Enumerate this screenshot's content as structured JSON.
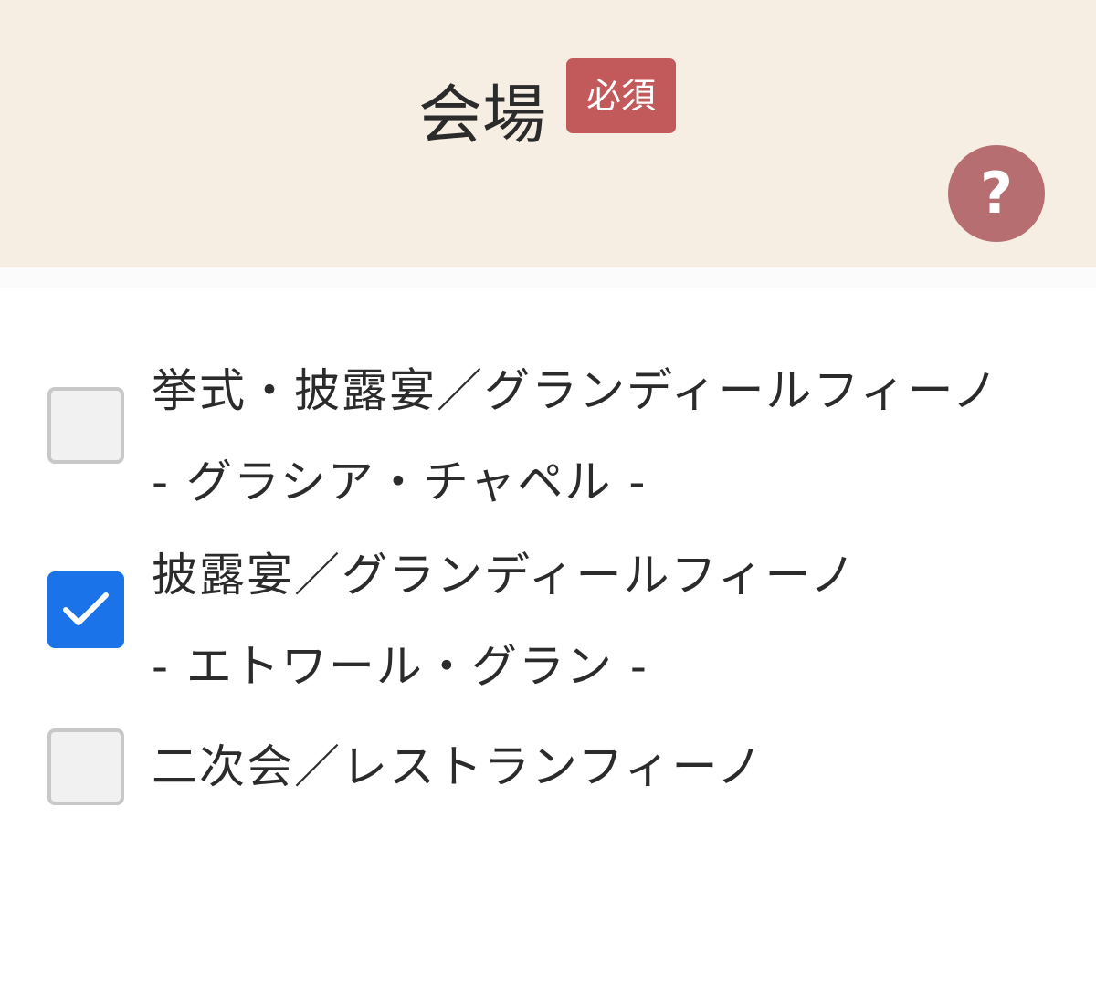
{
  "header": {
    "title": "会場",
    "required_badge": "必須",
    "help_icon": "question-mark-icon",
    "help_symbol": "?"
  },
  "options": [
    {
      "line1": "挙式・披露宴／グランディールフィーノ",
      "line2": "- グラシア・チャペル -",
      "checked": false
    },
    {
      "line1": "披露宴／グランディールフィーノ",
      "line2": "- エトワール・グラン -",
      "checked": true
    },
    {
      "line1": "二次会／レストランフィーノ",
      "line2": "",
      "checked": false
    }
  ],
  "colors": {
    "header_bg": "#f6ede3",
    "badge_bg": "#c2595b",
    "help_bg": "#b66e70",
    "checkbox_checked": "#1a73e8",
    "checkbox_unchecked_border": "#c8c8c8"
  }
}
